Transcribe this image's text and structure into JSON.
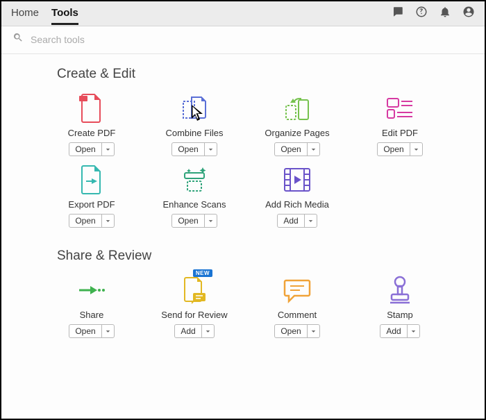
{
  "header": {
    "tab_home": "Home",
    "tab_tools": "Tools"
  },
  "search": {
    "placeholder": "Search tools"
  },
  "badges": {
    "new": "NEW"
  },
  "sections": {
    "create_edit": {
      "title": "Create & Edit"
    },
    "share_review": {
      "title": "Share & Review"
    }
  },
  "tools": {
    "create_pdf": {
      "label": "Create PDF",
      "action": "Open"
    },
    "combine": {
      "label": "Combine Files",
      "action": "Open"
    },
    "organize": {
      "label": "Organize Pages",
      "action": "Open"
    },
    "edit_pdf": {
      "label": "Edit PDF",
      "action": "Open"
    },
    "export_pdf": {
      "label": "Export PDF",
      "action": "Open"
    },
    "enhance": {
      "label": "Enhance Scans",
      "action": "Open"
    },
    "rich_media": {
      "label": "Add Rich Media",
      "action": "Add"
    },
    "share": {
      "label": "Share",
      "action": "Open"
    },
    "send_review": {
      "label": "Send for Review",
      "action": "Add"
    },
    "comment": {
      "label": "Comment",
      "action": "Open"
    },
    "stamp": {
      "label": "Stamp",
      "action": "Add"
    }
  }
}
